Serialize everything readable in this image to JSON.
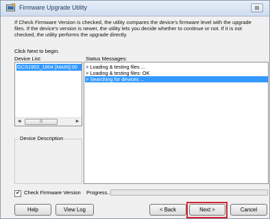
{
  "window": {
    "title": "Firmware Upgrade Utility",
    "close_label": "⊠"
  },
  "intro": {
    "text": "If Check Firmware Version is checked, the utility compares the device's firmware level with the upgrade files. If the device's version is newer, the utility lets you decide whether to continue or not. If it is not checked, the utility performs the upgrade directly.",
    "click_next": "Click Next to begin."
  },
  "device_list": {
    "label": "Device List:",
    "items": [
      "GCS1902_1904 [MAIN]:00"
    ],
    "selected_index": 0
  },
  "device_description": {
    "legend": "Device Description"
  },
  "status": {
    "label": "Status Messages:",
    "messages": [
      "> Loading & testing files ...",
      "> Loading & testing files: OK",
      "> Searching for devices ..."
    ],
    "selected_index": 2
  },
  "check_firmware": {
    "label": "Check Firmware Version",
    "checked": true
  },
  "progress": {
    "label": "Progress...",
    "value": 0
  },
  "buttons": {
    "help": "Help",
    "view_log": "View Log",
    "back": "< Back",
    "next": "Next >",
    "cancel": "Cancel"
  },
  "colors": {
    "selection": "#3399ff",
    "highlight": "#d2202e"
  }
}
